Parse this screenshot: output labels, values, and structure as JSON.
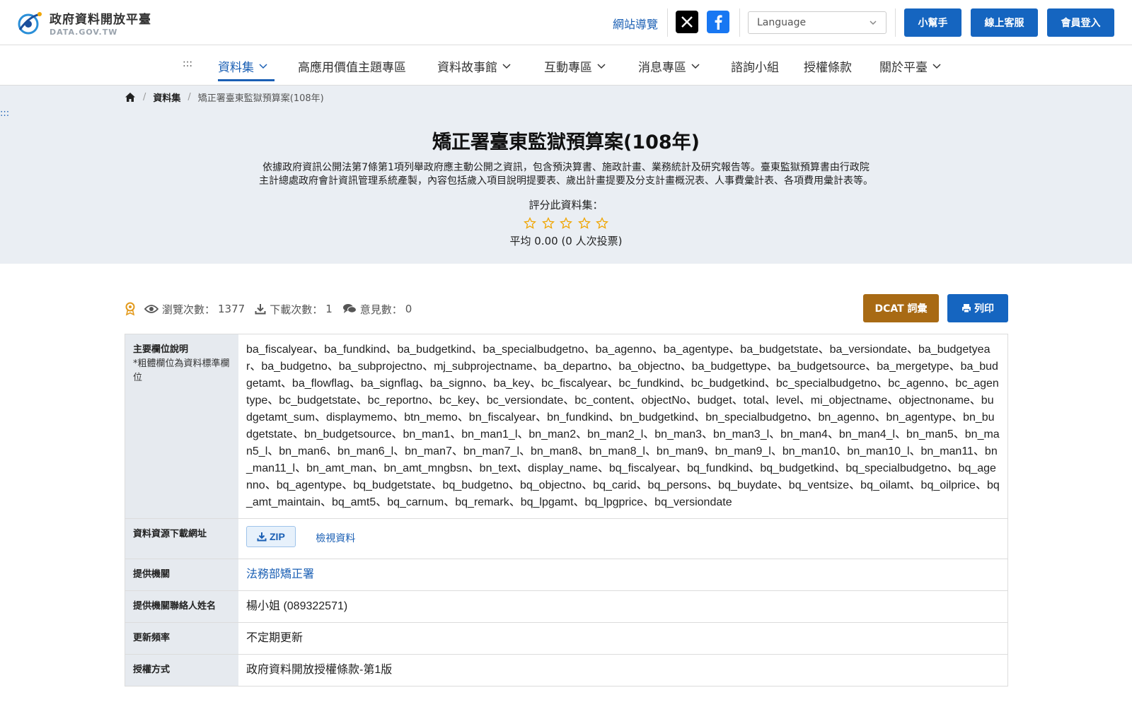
{
  "header": {
    "logo_title": "政府資料開放平臺",
    "logo_sub": "DATA.GOV.TW",
    "sitemap": "網站導覽",
    "language_placeholder": "Language",
    "help": "小幫手",
    "service": "線上客服",
    "login": "會員登入"
  },
  "nav": {
    "access_key": ":::",
    "items": [
      {
        "label": "資料集"
      },
      {
        "label": "高應用價值主題專區"
      },
      {
        "label": "資料故事館"
      },
      {
        "label": "互動專區"
      },
      {
        "label": "消息專區"
      },
      {
        "label": "諮詢小組"
      },
      {
        "label": "授權條款"
      },
      {
        "label": "關於平臺"
      }
    ]
  },
  "breadcrumb": {
    "items": [
      "資料集",
      "矯正署臺東監獄預算案(108年)"
    ]
  },
  "access_key_main": ":::",
  "dataset": {
    "title": "矯正署臺東監獄預算案(108年)",
    "description_line1": "依據政府資訊公開法第7條第1項列舉政府應主動公開之資訊，包含預決算書、施政計畫、業務統計及研究報告等。臺東監獄預算書由行政院",
    "description_line2": "主計總處政府會計資訊管理系統產製，內容包括歲入項目說明提要表、歲出計畫提要及分支計畫概況表、人事費彙計表、各項費用彙計表等。",
    "rate_label": "評分此資料集：",
    "rating_average": 0.0,
    "rating_max": 5,
    "rating_summary": "平均 0.00 (0 人次投票)"
  },
  "stats": {
    "views_label": "瀏覽次數：",
    "views": "1377",
    "downloads_label": "下載次數：",
    "downloads": "1",
    "comments_label": "意見數：",
    "comments": "0",
    "dcat": "DCAT 詞彙",
    "print": "列印"
  },
  "meta": {
    "fields_label": "主要欄位說明",
    "fields_note": "*粗體欄位為資料標準欄位",
    "fields_value": "ba_fiscalyear、ba_fundkind、ba_budgetkind、ba_specialbudgetno、ba_agenno、ba_agentype、ba_budgetstate、ba_versiondate、ba_budgetyear、ba_budgetno、ba_subprojectno、mj_subprojectname、ba_departno、ba_objectno、ba_budgettype、ba_budgetsource、ba_mergetype、ba_budgetamt、ba_flowflag、ba_signflag、ba_signno、ba_key、bc_fiscalyear、bc_fundkind、bc_budgetkind、bc_specialbudgetno、bc_agenno、bc_agentype、bc_budgetstate、bc_reportno、bc_key、bc_versiondate、bc_content、objectNo、budget、total、level、mi_objectname、objectnoname、budgetamt_sum、displaymemo、btn_memo、bn_fiscalyear、bn_fundkind、bn_budgetkind、bn_specialbudgetno、bn_agenno、bn_agentype、bn_budgetstate、bn_budgetsource、bn_man1、bn_man1_l、bn_man2、bn_man2_l、bn_man3、bn_man3_l、bn_man4、bn_man4_l、bn_man5、bn_man5_l、bn_man6、bn_man6_l、bn_man7、bn_man7_l、bn_man8、bn_man8_l、bn_man9、bn_man9_l、bn_man10、bn_man10_l、bn_man11、bn_man11_l、bn_amt_man、bn_amt_mngbsn、bn_text、display_name、bq_fiscalyear、bq_fundkind、bq_budgetkind、bq_specialbudgetno、bq_agenno、bq_agentype、bq_budgetstate、bq_budgetno、bq_objectno、bq_carid、bq_persons、bq_buydate、bq_ventsize、bq_oilamt、bq_oilprice、bq_amt_maintain、bq_amt5、bq_carnum、bq_remark、bq_lpgamt、bq_lpgprice、bq_versiondate",
    "download_label": "資料資源下載網址",
    "zip": "ZIP",
    "view_data": "檢視資料",
    "provider_label": "提供機關",
    "provider": "法務部矯正署",
    "contact_label": "提供機關聯絡人姓名",
    "contact": "楊小姐 (089322571)",
    "frequency_label": "更新頻率",
    "frequency": "不定期更新",
    "license_label": "授權方式",
    "license": "政府資料開放授權條款-第1版"
  },
  "colors": {
    "primary": "#1565c0",
    "dcat": "#a86a14",
    "hero_bg": "#eaeef3",
    "label_bg": "#e6eaef",
    "star": "#f0a500"
  }
}
